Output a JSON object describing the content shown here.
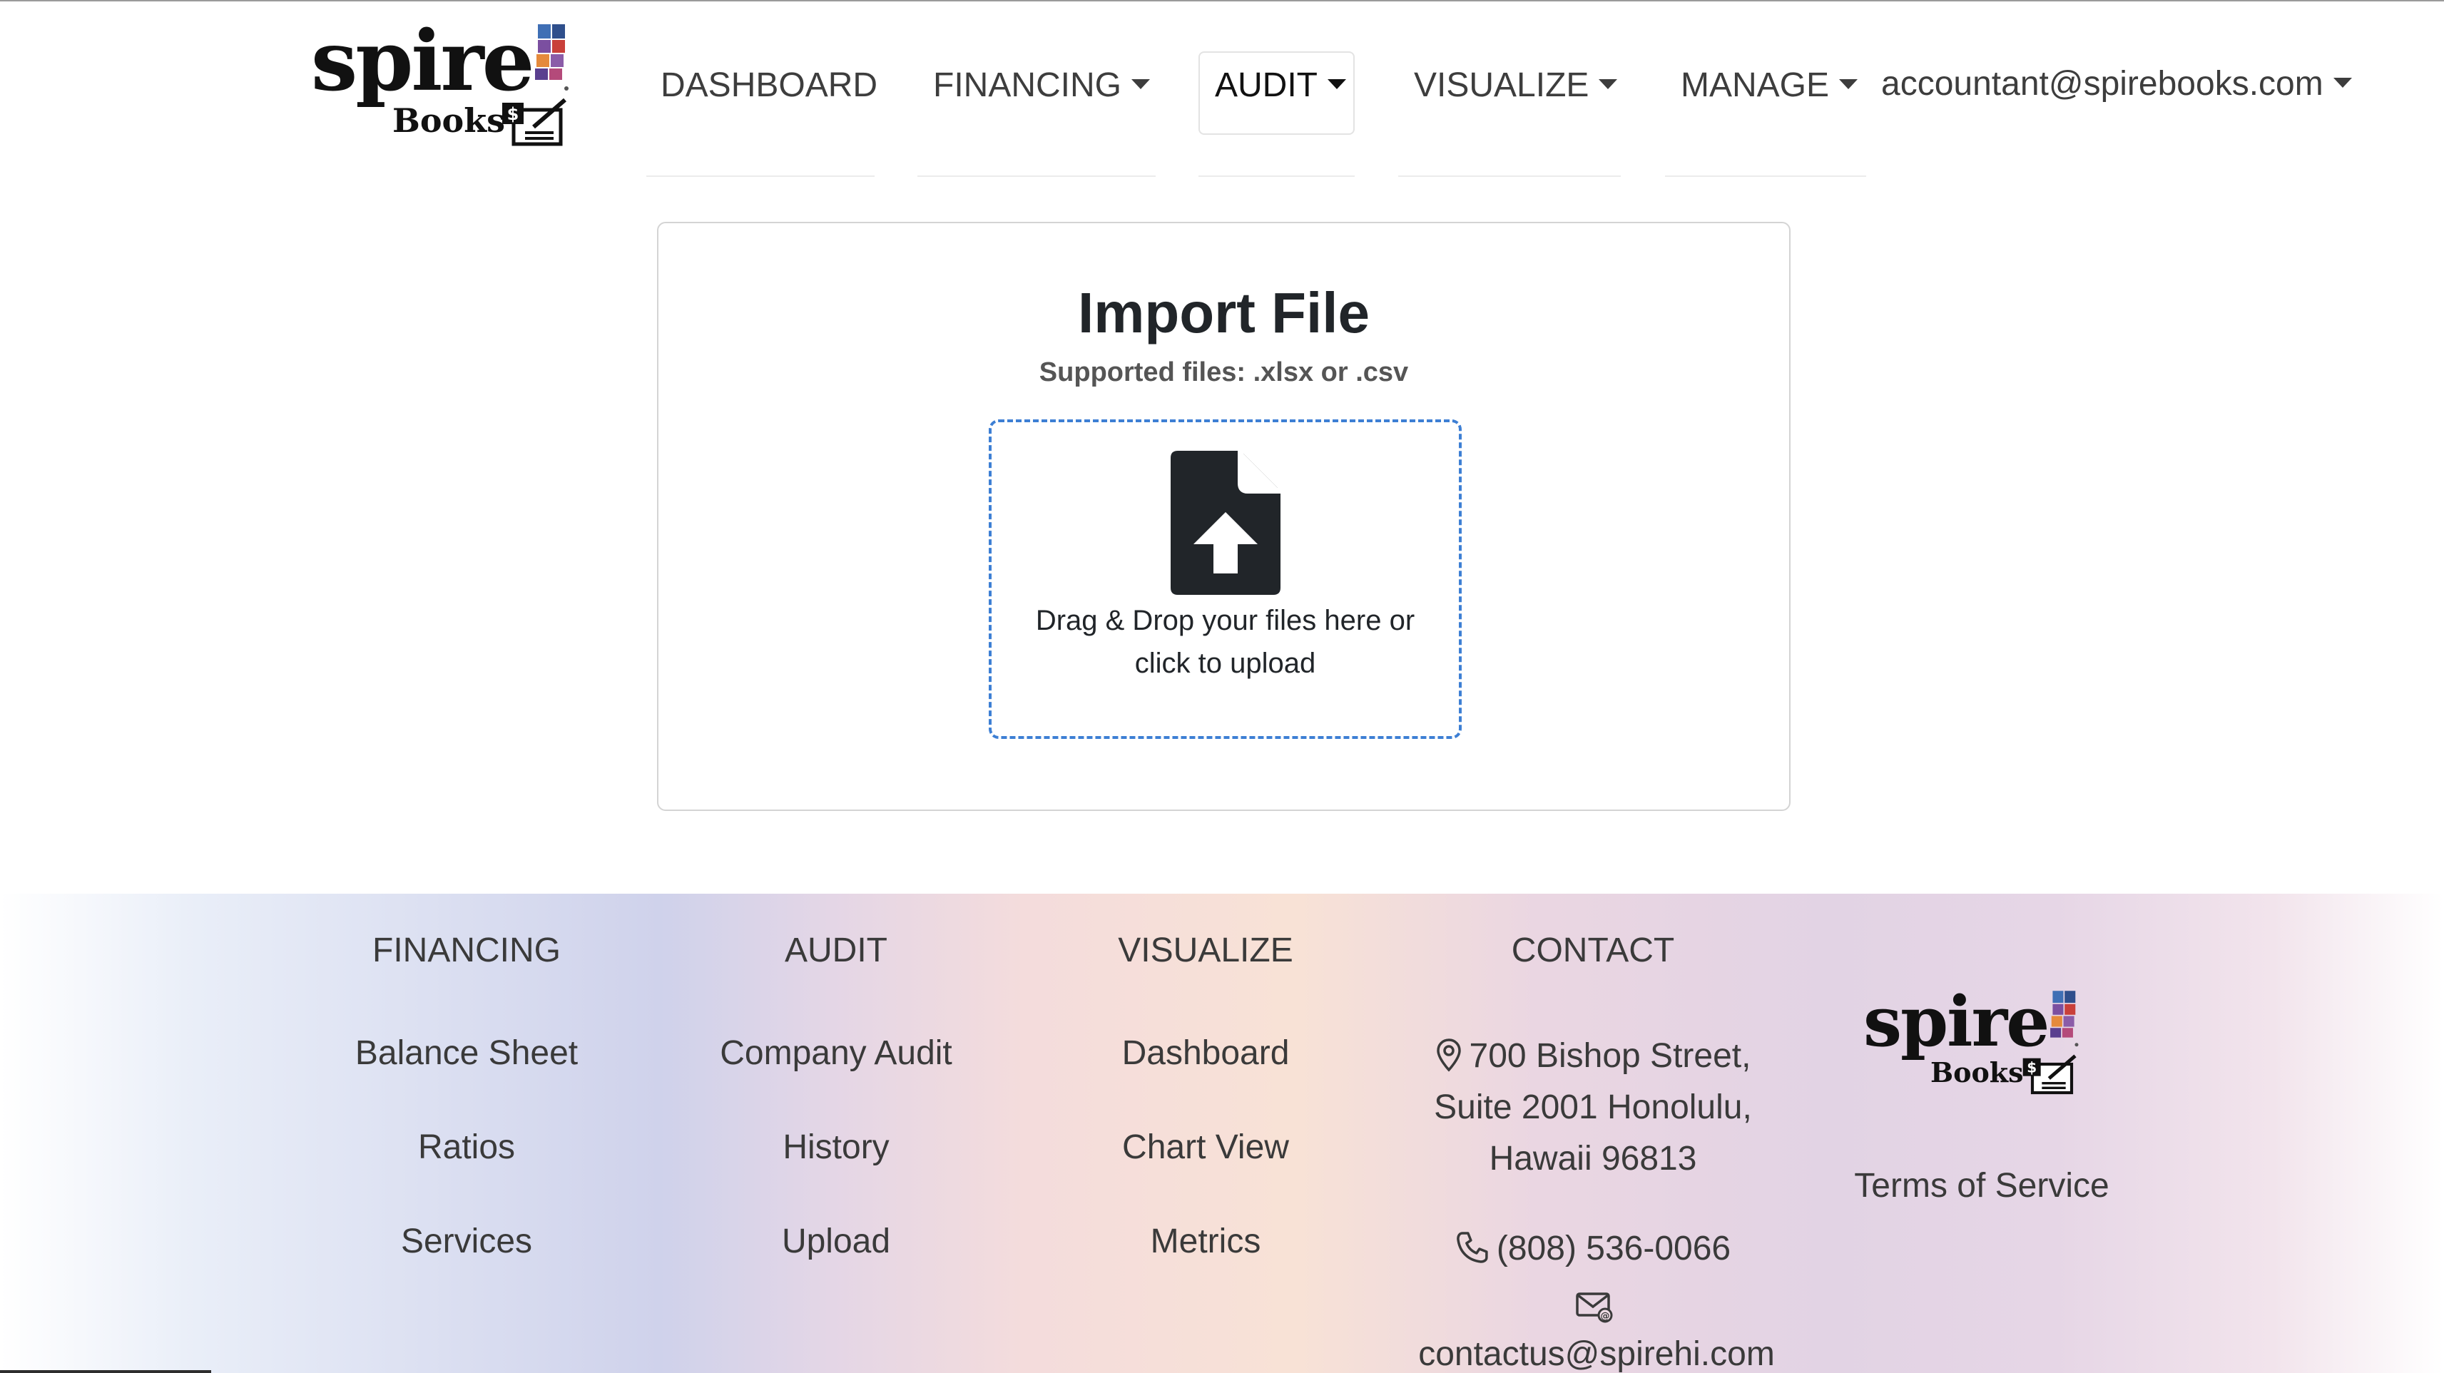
{
  "brand": {
    "word": "spire",
    "sub": "Books",
    "icon": "spire-books-logo"
  },
  "nav": {
    "items": [
      {
        "label": "DASHBOARD"
      },
      {
        "label": "FINANCING"
      },
      {
        "label": "AUDIT"
      },
      {
        "label": "VISUALIZE"
      },
      {
        "label": "MANAGE"
      }
    ],
    "active": "AUDIT",
    "account": "accountant@spirebooks.com"
  },
  "import": {
    "title": "Import File",
    "subtitle": "Supported files: .xlsx or .csv",
    "drop_line1": "Drag & Drop your files here or",
    "drop_line2": "click to upload",
    "icon": "file-upload-icon"
  },
  "footer": {
    "columns": [
      {
        "heading": "FINANCING",
        "links": [
          "Balance Sheet",
          "Ratios",
          "Services"
        ]
      },
      {
        "heading": "AUDIT",
        "links": [
          "Company Audit",
          "History",
          "Upload"
        ]
      },
      {
        "heading": "VISUALIZE",
        "links": [
          "Dashboard",
          "Chart View",
          "Metrics"
        ]
      }
    ],
    "contact": {
      "heading": "CONTACT",
      "address_line1": "700 Bishop Street,",
      "address_line2": "Suite 2001 Honolulu,",
      "address_line3": "Hawaii 96813",
      "phone": "(808) 536-0066",
      "email": "contactus@spirehi.com"
    },
    "terms": "Terms of Service"
  },
  "colors": {
    "dropzone_border": "#3d7fd4",
    "logo_blue": "#3f6fb5",
    "logo_purple": "#7b4fa0",
    "logo_orange": "#e58a3c",
    "logo_red": "#c9403a"
  }
}
